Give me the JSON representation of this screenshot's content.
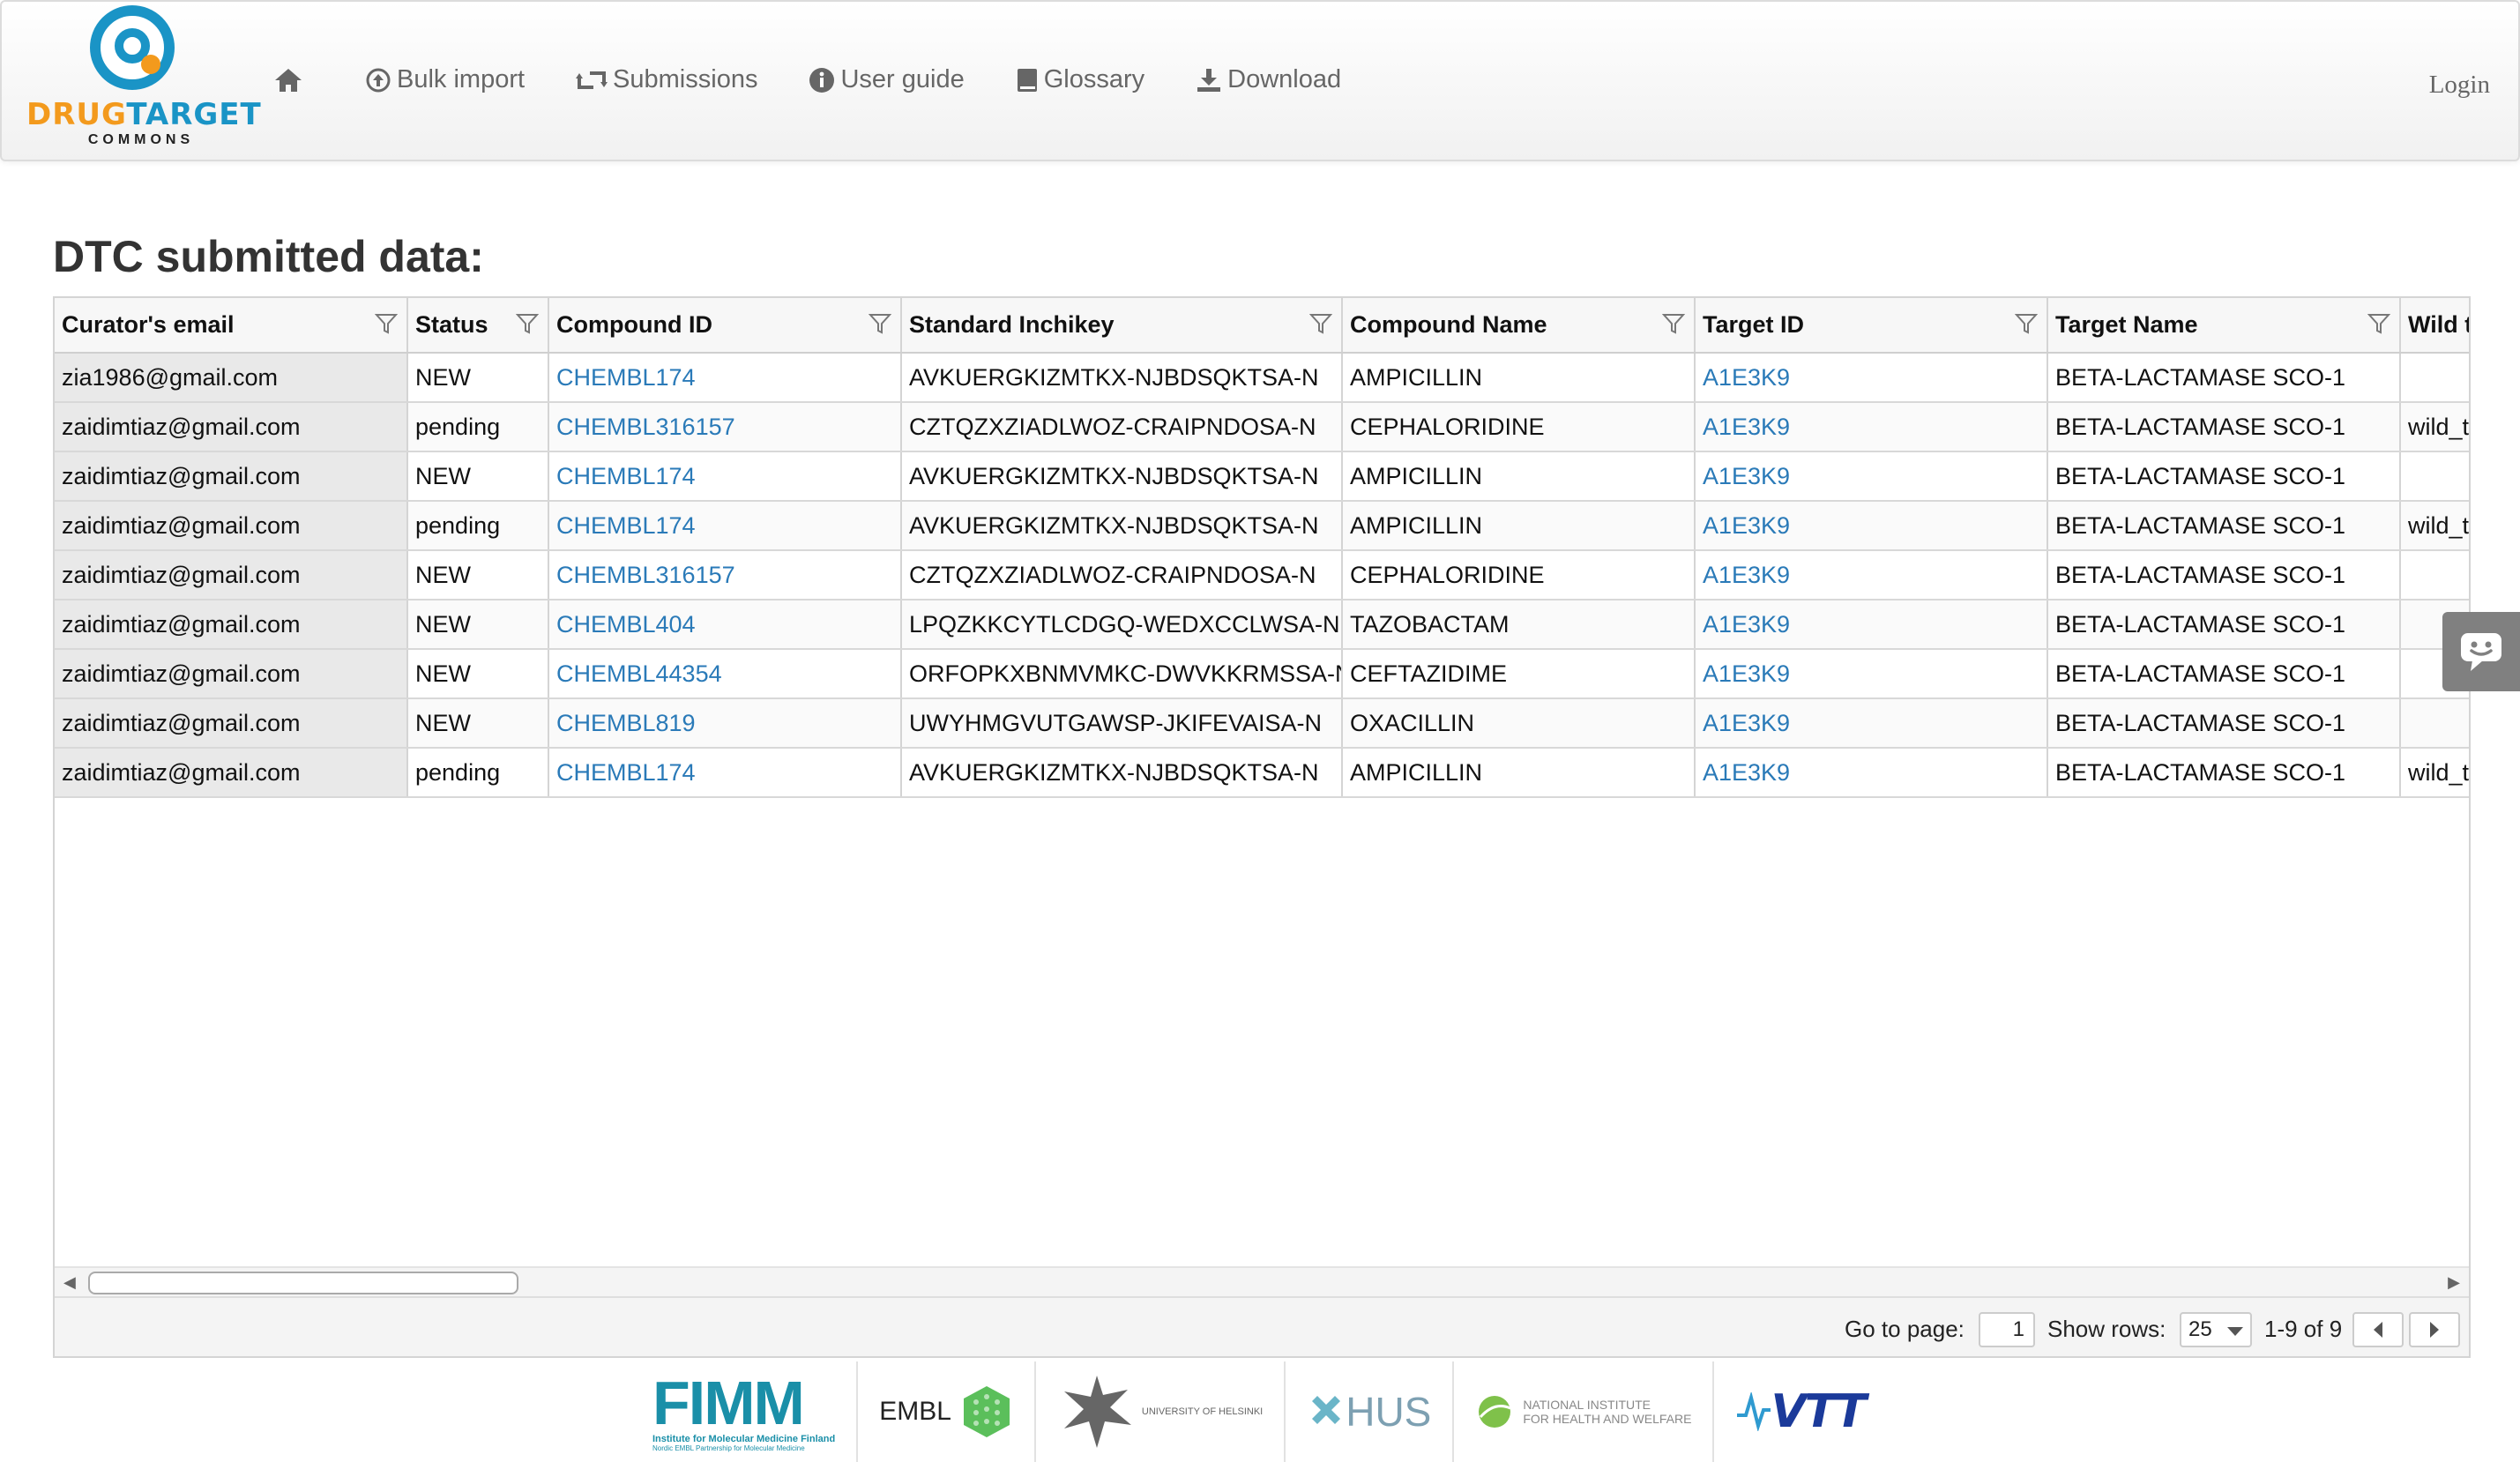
{
  "navbar": {
    "logo": {
      "word_drug": "DRUG",
      "word_target": "TARGET",
      "sub": "COMMONS",
      "icon": "dtc-logo-icon"
    },
    "items": [
      {
        "label": "",
        "icon": "home-icon"
      },
      {
        "label": "Bulk import",
        "icon": "upload-circle-icon"
      },
      {
        "label": "Submissions",
        "icon": "retweet-icon"
      },
      {
        "label": "User guide",
        "icon": "info-circle-icon"
      },
      {
        "label": "Glossary",
        "icon": "book-icon"
      },
      {
        "label": "Download",
        "icon": "download-icon"
      }
    ],
    "login_label": "Login"
  },
  "page_title": "DTC submitted data:",
  "table": {
    "columns": [
      "Curator's email",
      "Status",
      "Compound ID",
      "Standard Inchikey",
      "Compound Name",
      "Target ID",
      "Target Name",
      "Wild t"
    ],
    "rows": [
      [
        "zia1986@gmail.com",
        "NEW",
        "CHEMBL174",
        "AVKUERGKIZMTKX-NJBDSQKTSA-N",
        "AMPICILLIN",
        "A1E3K9",
        "BETA-LACTAMASE SCO-1",
        ""
      ],
      [
        "zaidimtiaz@gmail.com",
        "pending",
        "CHEMBL316157",
        "CZTQZXZIADLWOZ-CRAIPNDOSA-N",
        "CEPHALORIDINE",
        "A1E3K9",
        "BETA-LACTAMASE SCO-1",
        "wild_t"
      ],
      [
        "zaidimtiaz@gmail.com",
        "NEW",
        "CHEMBL174",
        "AVKUERGKIZMTKX-NJBDSQKTSA-N",
        "AMPICILLIN",
        "A1E3K9",
        "BETA-LACTAMASE SCO-1",
        ""
      ],
      [
        "zaidimtiaz@gmail.com",
        "pending",
        "CHEMBL174",
        "AVKUERGKIZMTKX-NJBDSQKTSA-N",
        "AMPICILLIN",
        "A1E3K9",
        "BETA-LACTAMASE SCO-1",
        "wild_t"
      ],
      [
        "zaidimtiaz@gmail.com",
        "NEW",
        "CHEMBL316157",
        "CZTQZXZIADLWOZ-CRAIPNDOSA-N",
        "CEPHALORIDINE",
        "A1E3K9",
        "BETA-LACTAMASE SCO-1",
        ""
      ],
      [
        "zaidimtiaz@gmail.com",
        "NEW",
        "CHEMBL404",
        "LPQZKKCYTLCDGQ-WEDXCCLWSA-N",
        "TAZOBACTAM",
        "A1E3K9",
        "BETA-LACTAMASE SCO-1",
        ""
      ],
      [
        "zaidimtiaz@gmail.com",
        "NEW",
        "CHEMBL44354",
        "ORFOPKXBNMVMKC-DWVKKRMSSA-N",
        "CEFTAZIDIME",
        "A1E3K9",
        "BETA-LACTAMASE SCO-1",
        ""
      ],
      [
        "zaidimtiaz@gmail.com",
        "NEW",
        "CHEMBL819",
        "UWYHMGVUTGAWSP-JKIFEVAISA-N",
        "OXACILLIN",
        "A1E3K9",
        "BETA-LACTAMASE SCO-1",
        ""
      ],
      [
        "zaidimtiaz@gmail.com",
        "pending",
        "CHEMBL174",
        "AVKUERGKIZMTKX-NJBDSQKTSA-N",
        "AMPICILLIN",
        "A1E3K9",
        "BETA-LACTAMASE SCO-1",
        "wild_t"
      ]
    ]
  },
  "pager": {
    "goto_label": "Go to page:",
    "page_value": "1",
    "show_rows_label": "Show rows:",
    "rows_value": "25",
    "range_text": "1-9 of 9"
  },
  "chat_widget": {
    "icon": "chat-bubble-icon"
  },
  "footer": {
    "fimm": {
      "name": "FIMM",
      "line1": "Institute for Molecular Medicine Finland",
      "line2": "Nordic EMBL Partnership for Molecular Medicine"
    },
    "embl": {
      "name": "EMBL"
    },
    "uh": {
      "name": "UNIVERSITY OF HELSINKI"
    },
    "hus": {
      "name": "HUS"
    },
    "thl": {
      "line1": "NATIONAL INSTITUTE",
      "line2": "FOR HEALTH AND WELFARE"
    },
    "vtt": {
      "name": "VTT"
    }
  },
  "colors": {
    "link": "#2a7ab8",
    "brand_blue": "#1a94c6",
    "brand_orange": "#f39a1d",
    "email_col_bg": "#e9e9e9"
  }
}
